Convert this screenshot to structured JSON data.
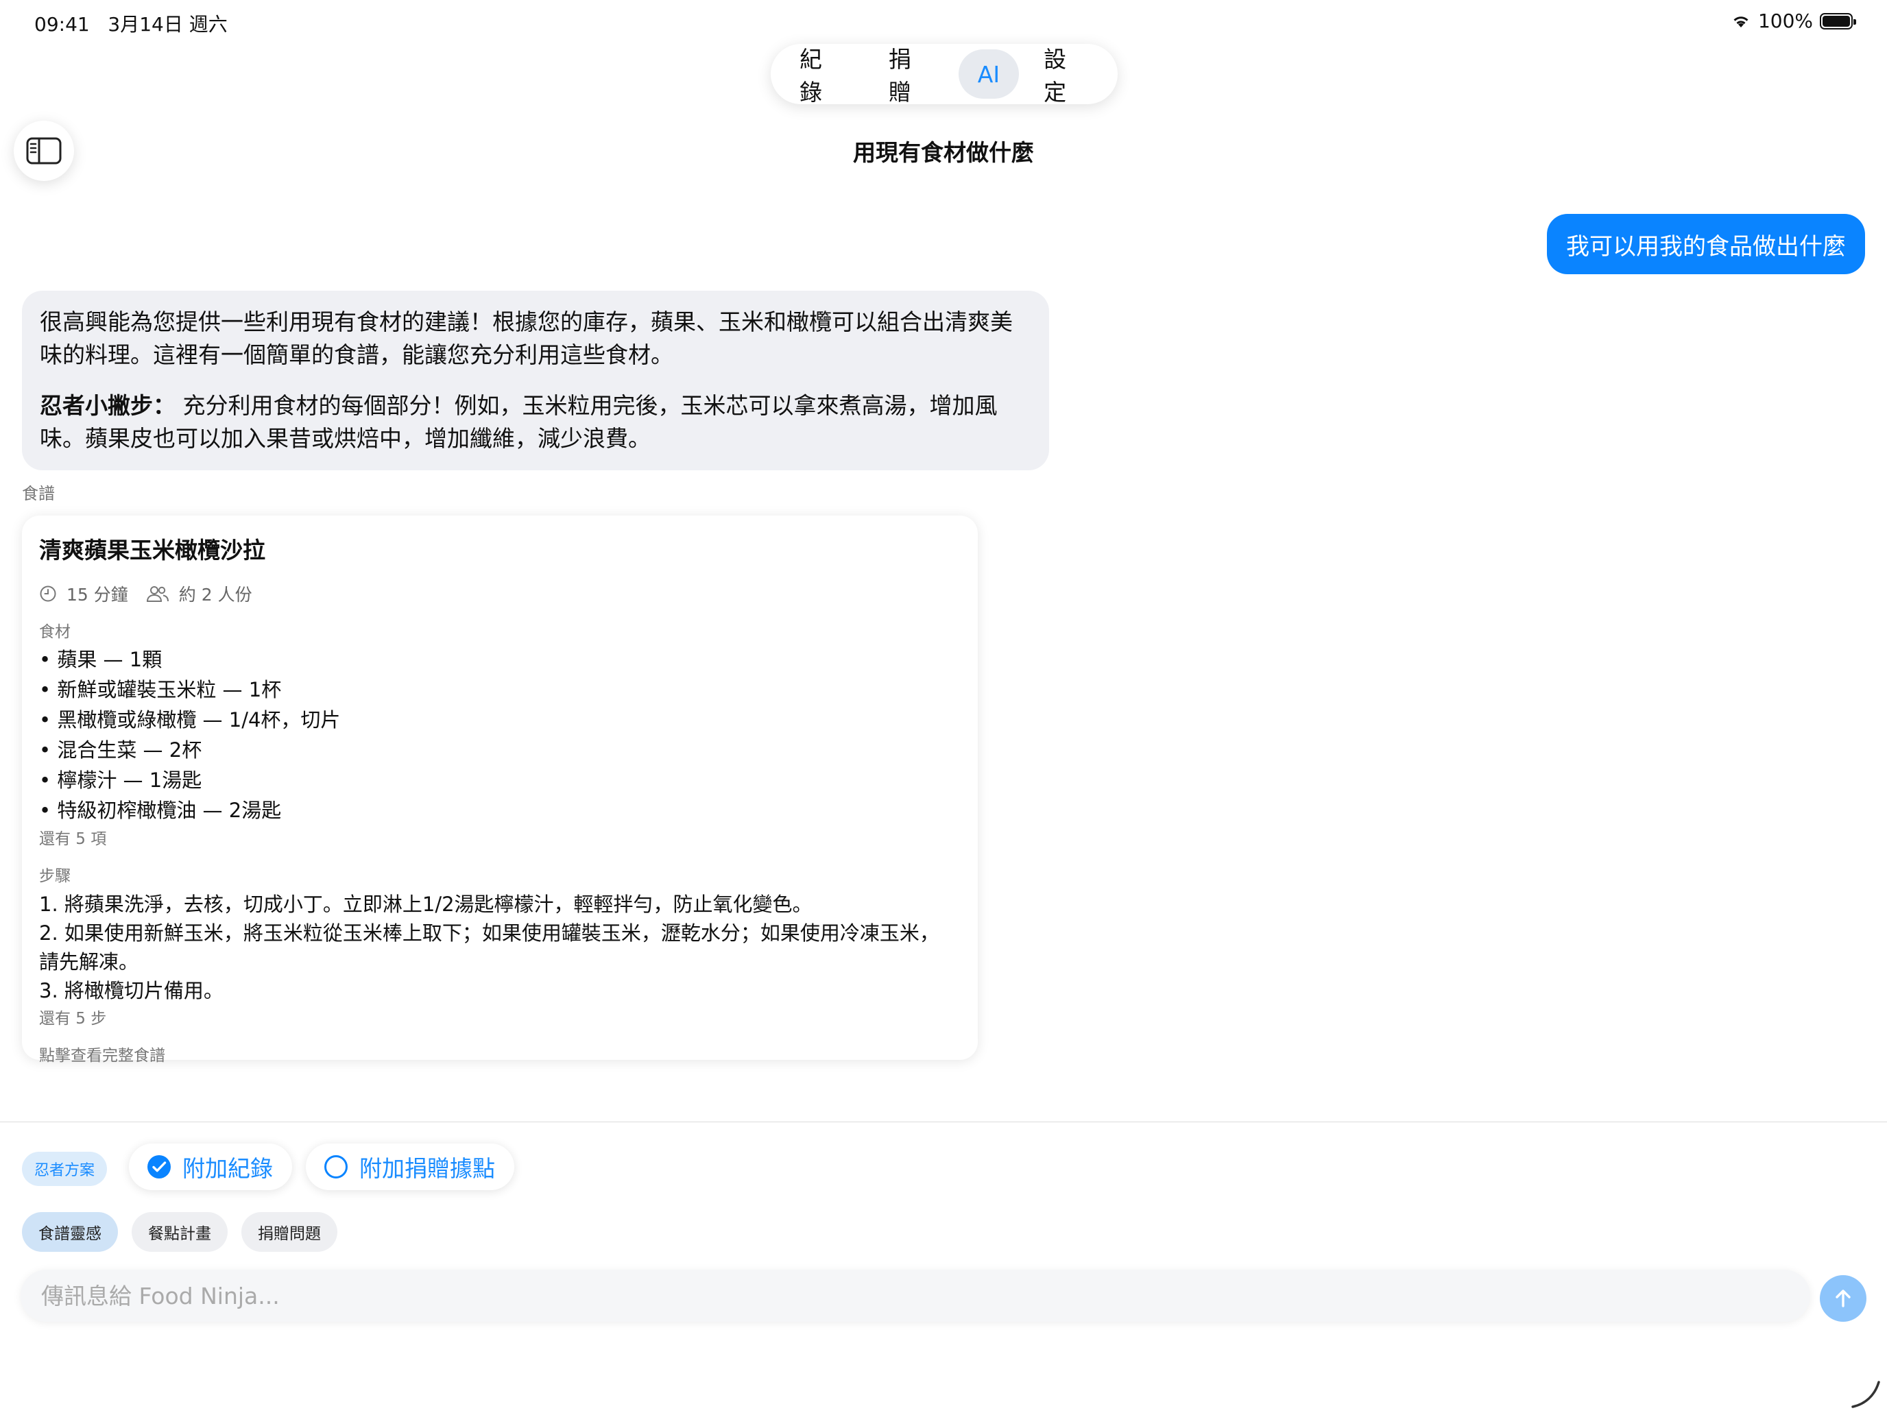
{
  "status_bar": {
    "time": "09:41",
    "date": "3月14日 週六",
    "battery": "100%"
  },
  "tabs": [
    {
      "label": "紀錄",
      "active": false
    },
    {
      "label": "捐贈",
      "active": false
    },
    {
      "label": "AI",
      "active": true
    },
    {
      "label": "設定",
      "active": false
    }
  ],
  "page_title": "用現有食材做什麼",
  "user_message": "我可以用我的食品做出什麼",
  "ai_message": {
    "paragraph1": "很高興能為您提供一些利用現有食材的建議！根據您的庫存，蘋果、玉米和橄欖可以組合出清爽美味的料理。這裡有一個簡單的食譜，能讓您充分利用這些食材。",
    "tip_title": "忍者小撇步：",
    "tip_text": " 充分利用食材的每個部分！例如，玉米粒用完後，玉米芯可以拿來煮高湯，增加風味。蘋果皮也可以加入果昔或烘焙中，增加纖維，減少浪費。"
  },
  "recipe_section_label": "食譜",
  "recipe": {
    "title": "清爽蘋果玉米橄欖沙拉",
    "time": "15 分鐘",
    "servings": "約 2 人份",
    "ingredients_label": "食材",
    "ingredients": [
      "• 蘋果 — 1顆",
      "• 新鮮或罐裝玉米粒 — 1杯",
      "• 黑橄欖或綠橄欖 — 1/4杯，切片",
      "• 混合生菜 — 2杯",
      "• 檸檬汁 — 1湯匙",
      "• 特級初榨橄欖油 — 2湯匙"
    ],
    "ingredients_more": "還有 5 項",
    "steps_label": "步驟",
    "steps": [
      "1. 將蘋果洗淨，去核，切成小丁。立即淋上1/2湯匙檸檬汁，輕輕拌勻，防止氧化變色。",
      "2. 如果使用新鮮玉米，將玉米粒從玉米棒上取下；如果使用罐裝玉米，瀝乾水分；如果使用冷凍玉米，請先解凍。",
      "3. 將橄欖切片備用。"
    ],
    "steps_more": "還有 5 步",
    "view_full": "點擊查看完整食譜"
  },
  "bottom": {
    "plan_badge": "忍者方案",
    "attach_records": "附加紀錄",
    "attach_records_checked": true,
    "attach_donation": "附加捐贈據點",
    "attach_donation_checked": false,
    "chips": [
      {
        "label": "食譜靈感",
        "active": true
      },
      {
        "label": "餐點計畫",
        "active": false
      },
      {
        "label": "捐贈問題",
        "active": false
      }
    ],
    "input_placeholder": "傳訊息給 Food Ninja...",
    "input_value": ""
  },
  "colors": {
    "accent": "#0a84ff",
    "send_disabled": "#8cc4fb",
    "ai_bubble": "#eff0f4"
  }
}
